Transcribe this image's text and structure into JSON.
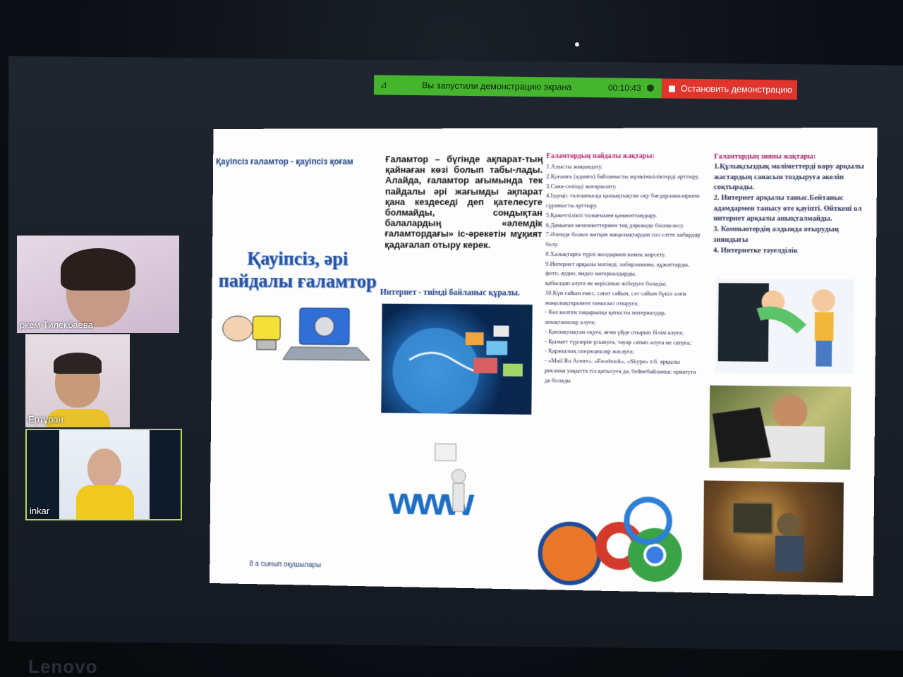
{
  "share_bar": {
    "message": "Вы запустили демонстрацию экрана",
    "timer": "00:10:43",
    "stop_label": "Остановить демонстрацию"
  },
  "participants": [
    {
      "name": "ркем Тилекбаева"
    },
    {
      "name": "Ертұран"
    },
    {
      "name": "inkar"
    }
  ],
  "slide": {
    "small_title": "Қауіпсіз ғаламтор - қауіпсіз қоғам",
    "big_title": "Қауіпсіз, әрі пайдалы ғаламтор",
    "main_text": "Ғаламтор – бүгінде ақпарат-тың қайнаған көзі болып табы-лады. Алайда, ғаламтор ағымында тек пайдалы әрі жағымды ақпарат қана кездеседі деп қателесуге болмайды, сондықтан балалардың «әлемдік ғаламтордағы» іс-әрекетін мұқият қадағалап отыру керек.",
    "internet_line": "Интернет - тиімді байланыс құралы.",
    "footer": "8 а сынып оқушылары",
    "benefits_title": "Ғаламтордың пайдалы жақтары:",
    "benefits": [
      "1.Алысты жақындату.",
      "2.Қоғамға (адамға) байланысты мүмкіншіліктерді арттыру.",
      "3.Сана-сезімді жоғарылату.",
      "4.Іздеңіс талпынысқа қашықтықтан оқу бағдарламаларына сұранысты арттыру.",
      "5.Қажеттілікті толығымен қанағаттандыру.",
      "6.Дамыған мемлекеттермен тең дәрежеде бәсекелесу.",
      "7.Әлемде болып жатқан жаңалықтардан сол сәтте хабардар болу.",
      "8.Халықтарға түрлі жолдармен көмек көрсету.",
      "9.Интернет арқылы мәтінді, хабарламаны, құжаттарды, фото, аудио, видео материалдарды,",
      "қабылдап алуға не керісінше жіберуге болады;",
      "10.Күн сайын емес, сағат сайын, сәт сайын бүкіл әлем жаңалықтарымен танысып отыруға,",
      "- Көз көлген тақырыпқа қатысты материалдар, анықтамалар алуға;",
      "- Қашықтықтан оқуға, яғни үйде отырып білім алуға;",
      "- Қызмет түрлерін ұсынуға, тауар сатып алуға не сатуға;",
      "- Қаржылық операциялар жасауға;",
      "- «Mail.Ru Агент», «Facebook», «Skype» т.б. арқылы реклама уақытта тіл қатысуға да, бейнебайланыс орнатуға да болады"
    ],
    "harms_title": "Ғаламтордың зияны жақтары:",
    "harms": [
      "1.Құлықсыздық мәліметтерді көру арқылы жастардың санасын тоздыруға әкеліп соқтырады.",
      "2. Интернет арқылы таныс.Бейтаныс адамдармен танысу өте қауіпті. Өйткені ол интернет арқылы анықталмайды.",
      "3. Компьютердің алдында отырудың зияндығы",
      "4. Интернетке тәуелділік"
    ]
  },
  "brand": "Lenovo",
  "colors": {
    "share_green": "#44b52c",
    "stop_red": "#e0342c",
    "title_blue": "#2452a5"
  }
}
